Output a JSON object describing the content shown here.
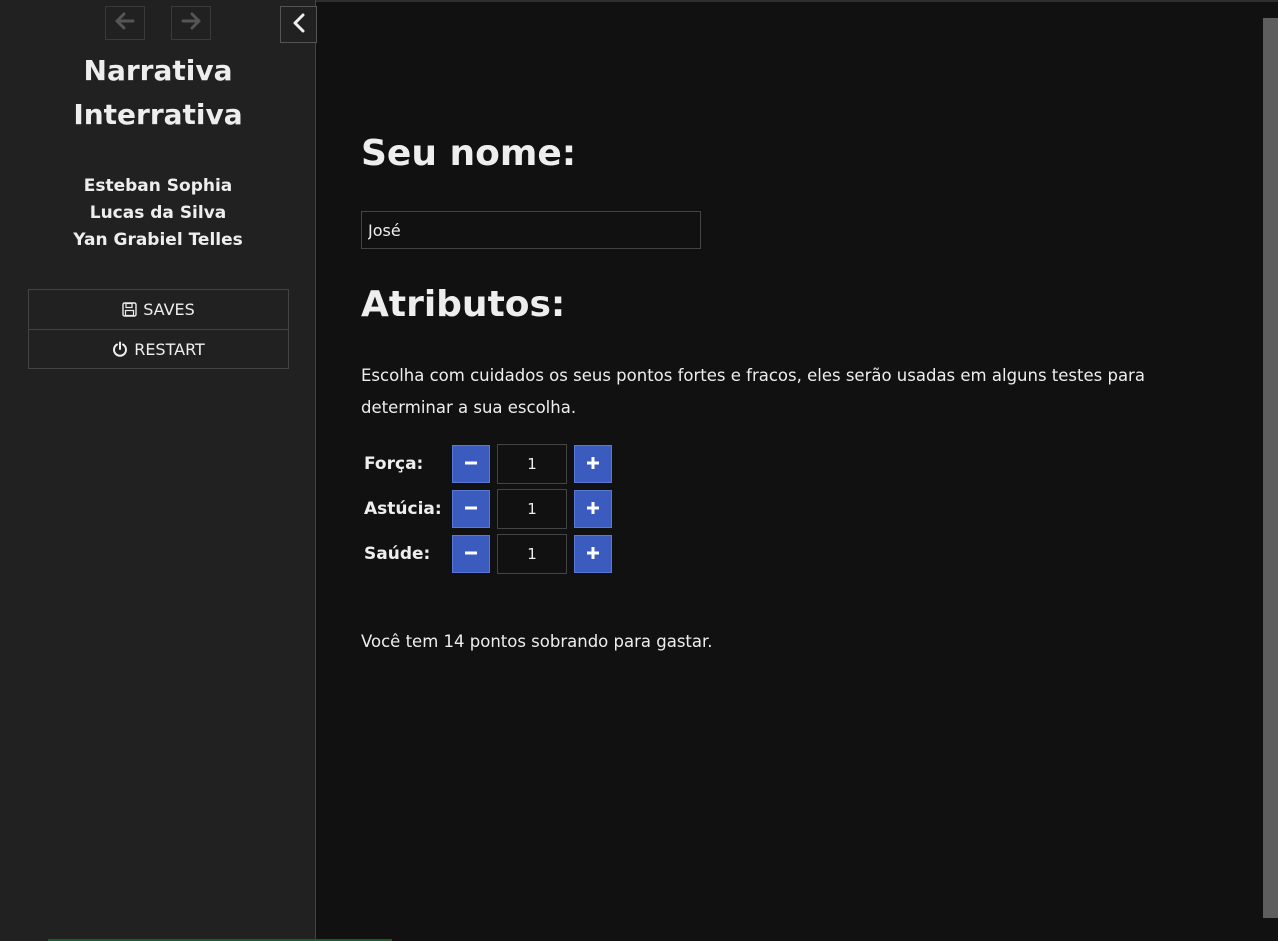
{
  "sidebar": {
    "history_back_icon": "arrow-left-icon",
    "history_forward_icon": "arrow-right-icon",
    "stow_icon": "chevron-left-icon",
    "title_line1": "Narrativa",
    "title_line2": "Interrativa",
    "authors": [
      "Esteban Sophia",
      "Lucas da Silva",
      "Yan Grabiel Telles"
    ],
    "menu": {
      "saves_label": "SAVES",
      "saves_icon": "floppy-disk-icon",
      "restart_label": "RESTART",
      "restart_icon": "power-icon"
    }
  },
  "passage": {
    "name_heading": "Seu nome:",
    "name_value": "José",
    "attributes_heading": "Atributos:",
    "intro_text": "Escolha com cuidados os seus pontos fortes e fracos, eles serão usadas em alguns testes para determinar a sua escolha.",
    "attributes": [
      {
        "label": "Força:",
        "value": "1"
      },
      {
        "label": "Astúcia:",
        "value": "1"
      },
      {
        "label": "Saúde:",
        "value": "1"
      }
    ],
    "points_text": "Você tem 14 pontos sobrando para gastar."
  },
  "colors": {
    "background": "#111111",
    "sidebar": "#212121",
    "button_accent": "#3b5bbf",
    "text": "#eeeeee"
  }
}
